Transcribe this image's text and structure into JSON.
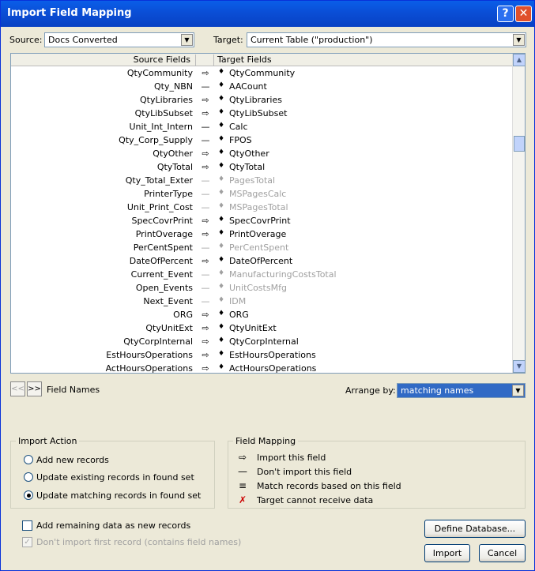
{
  "window": {
    "title": "Import Field Mapping",
    "help_label": "?",
    "close_label": "✕"
  },
  "source": {
    "label": "Source:",
    "value": "Docs Converted"
  },
  "target": {
    "label": "Target:",
    "value": "Current Table (\"production\")"
  },
  "grid": {
    "source_header": "Source Fields",
    "target_header": "Target Fields",
    "rows": [
      {
        "src": "QtyCommunity",
        "arrow": "⇨",
        "tgt": "QtyCommunity",
        "on": true
      },
      {
        "src": "Qty_NBN",
        "arrow": "—",
        "tgt": "AACount",
        "on": true
      },
      {
        "src": "QtyLibraries",
        "arrow": "⇨",
        "tgt": "QtyLibraries",
        "on": true
      },
      {
        "src": "QtyLibSubset",
        "arrow": "⇨",
        "tgt": "QtyLibSubset",
        "on": true
      },
      {
        "src": "Unit_Int_Intern",
        "arrow": "—",
        "tgt": "Calc",
        "on": true
      },
      {
        "src": "Qty_Corp_Supply",
        "arrow": "—",
        "tgt": "FPOS",
        "on": true
      },
      {
        "src": "QtyOther",
        "arrow": "⇨",
        "tgt": "QtyOther",
        "on": true
      },
      {
        "src": "QtyTotal",
        "arrow": "⇨",
        "tgt": "QtyTotal",
        "on": true
      },
      {
        "src": "Qty_Total_Exter",
        "arrow": "—",
        "tgt": "PagesTotal",
        "on": false
      },
      {
        "src": "PrinterType",
        "arrow": "—",
        "tgt": "MSPagesCalc",
        "on": false
      },
      {
        "src": "Unit_Print_Cost",
        "arrow": "—",
        "tgt": "MSPagesTotal",
        "on": false
      },
      {
        "src": "SpecCovrPrint",
        "arrow": "⇨",
        "tgt": "SpecCovrPrint",
        "on": true
      },
      {
        "src": "PrintOverage",
        "arrow": "⇨",
        "tgt": "PrintOverage",
        "on": true
      },
      {
        "src": "PerCentSpent",
        "arrow": "—",
        "tgt": "PerCentSpent",
        "on": false
      },
      {
        "src": "DateOfPercent",
        "arrow": "⇨",
        "tgt": "DateOfPercent",
        "on": true
      },
      {
        "src": "Current_Event",
        "arrow": "—",
        "tgt": "ManufacturingCostsTotal",
        "on": false
      },
      {
        "src": "Open_Events",
        "arrow": "—",
        "tgt": "UnitCostsMfg",
        "on": false
      },
      {
        "src": "Next_Event",
        "arrow": "—",
        "tgt": "IDM",
        "on": false
      },
      {
        "src": "ORG",
        "arrow": "⇨",
        "tgt": "ORG",
        "on": true
      },
      {
        "src": "QtyUnitExt",
        "arrow": "⇨",
        "tgt": "QtyUnitExt",
        "on": true
      },
      {
        "src": "QtyCorpInternal",
        "arrow": "⇨",
        "tgt": "QtyCorpInternal",
        "on": true
      },
      {
        "src": "EstHoursOperations",
        "arrow": "⇨",
        "tgt": "EstHoursOperations",
        "on": true
      },
      {
        "src": "ActHoursOperations",
        "arrow": "⇨",
        "tgt": "ActHoursOperations",
        "on": true
      }
    ],
    "row_dot": "♦"
  },
  "nav": {
    "prev": "<<",
    "next": ">>",
    "label": "Field Names"
  },
  "arrange": {
    "label": "Arrange by:",
    "value": "matching names"
  },
  "import_action": {
    "title": "Import Action",
    "options": [
      "Add new records",
      "Update existing records in found set",
      "Update matching records in found set"
    ]
  },
  "field_mapping": {
    "title": "Field Mapping",
    "items": [
      {
        "icon": "⇨",
        "label": "Import this field"
      },
      {
        "icon": "—",
        "label": "Don't import this field"
      },
      {
        "icon": "≡",
        "label": "Match records based on this field"
      },
      {
        "icon": "✗",
        "label": "Target cannot receive data"
      }
    ]
  },
  "checks": {
    "add_remaining": "Add remaining data as new records",
    "dont_import_first": "Don't import first record (contains field names)",
    "check_mark": "✓"
  },
  "buttons": {
    "define_db": "Define Database...",
    "import": "Import",
    "cancel": "Cancel"
  }
}
